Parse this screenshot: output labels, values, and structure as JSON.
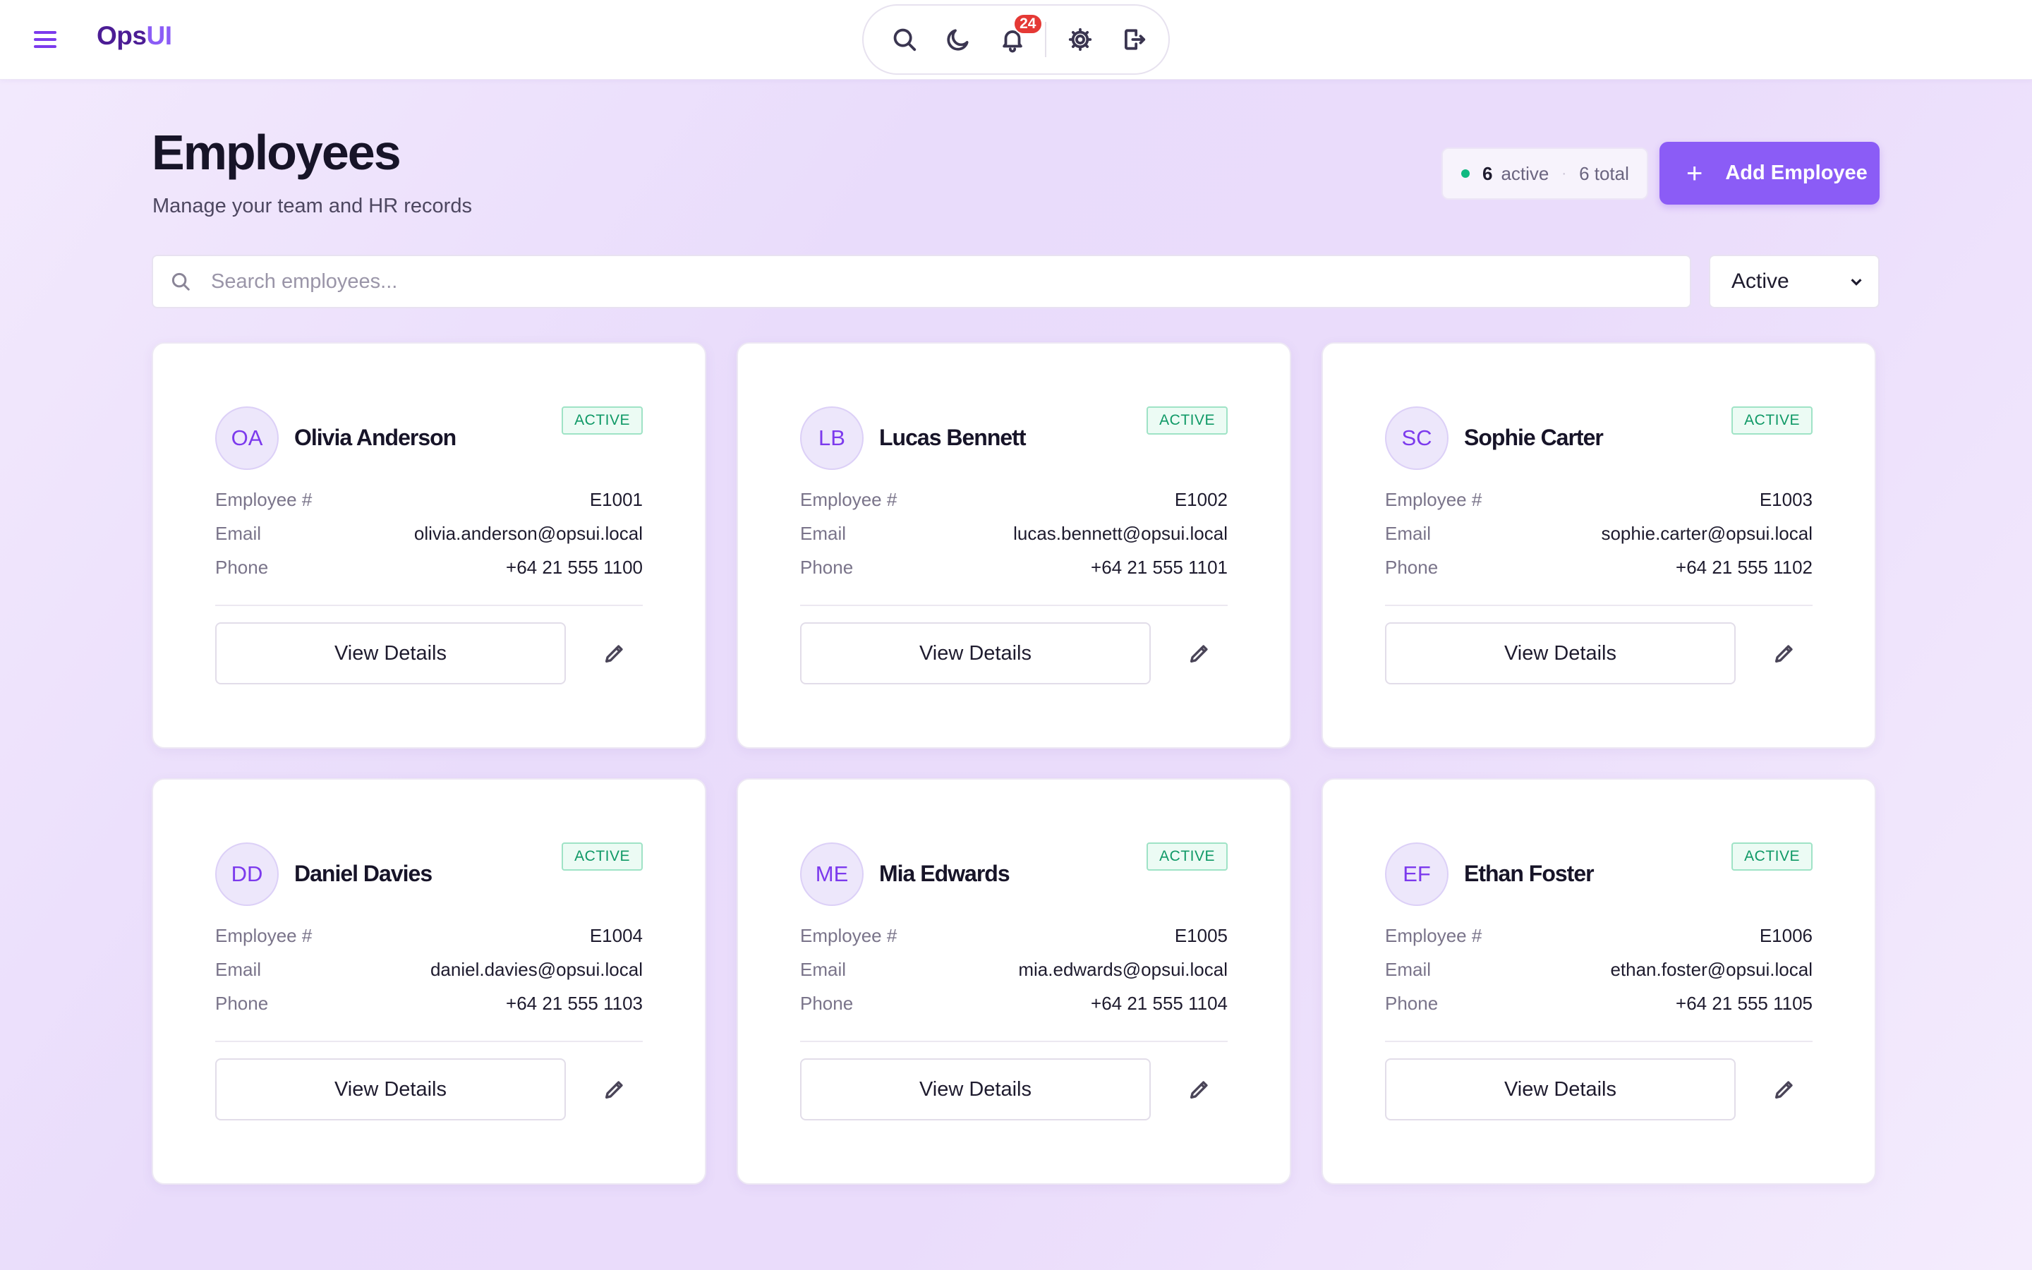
{
  "app": {
    "brand_part1": "Ops",
    "brand_part2": "UI",
    "notification_count": "24",
    "icons": [
      "menu-icon",
      "search-icon",
      "moon-icon",
      "bell-icon",
      "gear-icon",
      "logout-icon"
    ]
  },
  "header": {
    "title": "Employees",
    "subtitle": "Manage your team and HR records",
    "active_count": "6",
    "active_label": "active",
    "separator": "·",
    "total_label": "6 total",
    "add_button_label": "Add Employee"
  },
  "search": {
    "placeholder": "Search employees...",
    "value": ""
  },
  "filter": {
    "selected": "Active"
  },
  "labels": {
    "employee_number": "Employee #",
    "email": "Email",
    "phone": "Phone",
    "view_details": "View Details"
  },
  "colors": {
    "accent": "#8b5cf6",
    "brand_dark": "#4c1d95",
    "status_active": "#0f9966",
    "badge": "#e53935"
  },
  "employees": [
    {
      "initials": "OA",
      "name": "Olivia Anderson",
      "status": "ACTIVE",
      "number": "E1001",
      "email": "olivia.anderson@opsui.local",
      "phone": "+64 21 555 1100"
    },
    {
      "initials": "LB",
      "name": "Lucas Bennett",
      "status": "ACTIVE",
      "number": "E1002",
      "email": "lucas.bennett@opsui.local",
      "phone": "+64 21 555 1101"
    },
    {
      "initials": "SC",
      "name": "Sophie Carter",
      "status": "ACTIVE",
      "number": "E1003",
      "email": "sophie.carter@opsui.local",
      "phone": "+64 21 555 1102"
    },
    {
      "initials": "DD",
      "name": "Daniel Davies",
      "status": "ACTIVE",
      "number": "E1004",
      "email": "daniel.davies@opsui.local",
      "phone": "+64 21 555 1103"
    },
    {
      "initials": "ME",
      "name": "Mia Edwards",
      "status": "ACTIVE",
      "number": "E1005",
      "email": "mia.edwards@opsui.local",
      "phone": "+64 21 555 1104"
    },
    {
      "initials": "EF",
      "name": "Ethan Foster",
      "status": "ACTIVE",
      "number": "E1006",
      "email": "ethan.foster@opsui.local",
      "phone": "+64 21 555 1105"
    }
  ]
}
